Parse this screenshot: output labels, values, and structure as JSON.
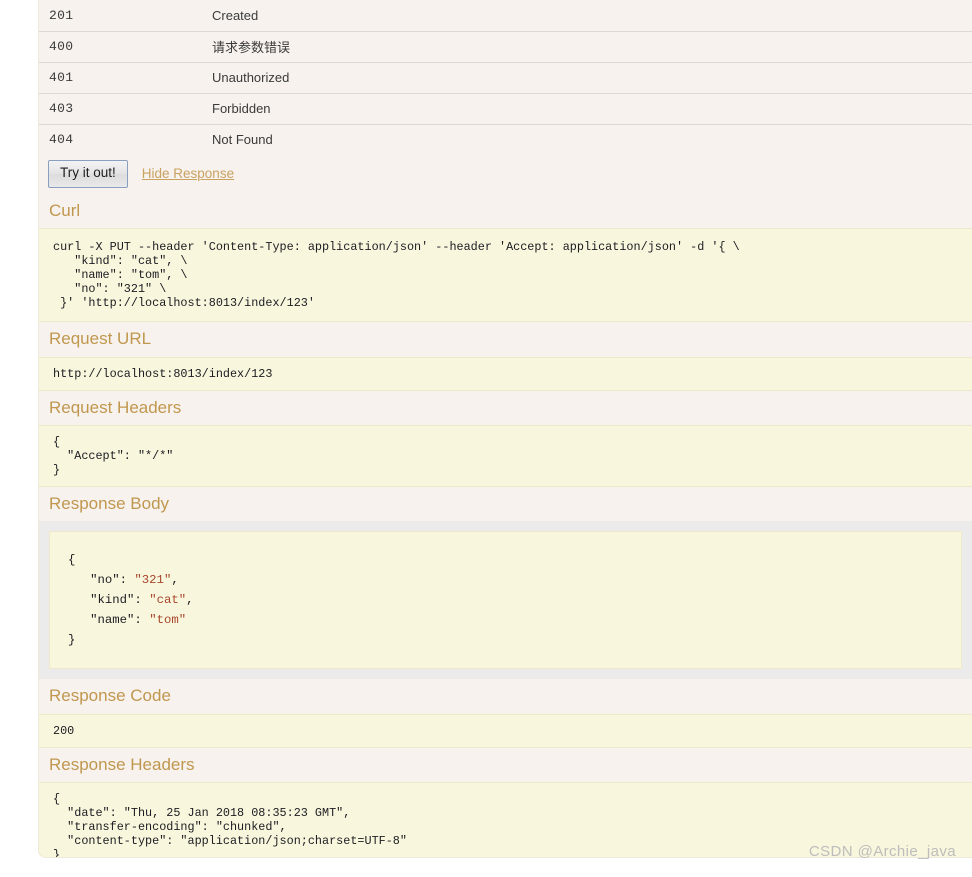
{
  "response_codes": {
    "rows": [
      {
        "code": "201",
        "reason": "Created"
      },
      {
        "code": "400",
        "reason": "请求参数错误"
      },
      {
        "code": "401",
        "reason": "Unauthorized"
      },
      {
        "code": "403",
        "reason": "Forbidden"
      },
      {
        "code": "404",
        "reason": "Not Found"
      }
    ]
  },
  "actions": {
    "try_it_out_label": "Try it out!",
    "hide_response_label": "Hide Response"
  },
  "sections": {
    "curl": {
      "title": "Curl",
      "content": "curl -X PUT --header 'Content-Type: application/json' --header 'Accept: application/json' -d '{ \\\n   \"kind\": \"cat\", \\\n   \"name\": \"tom\", \\\n   \"no\": \"321\" \\\n }' 'http://localhost:8013/index/123'"
    },
    "request_url": {
      "title": "Request URL",
      "content": "http://localhost:8013/index/123"
    },
    "request_headers": {
      "title": "Request Headers",
      "content": "{\n  \"Accept\": \"*/*\"\n}"
    },
    "response_body": {
      "title": "Response Body",
      "lines": [
        {
          "indent": 0,
          "text": "{",
          "type": "punct"
        },
        {
          "indent": 1,
          "key": "\"no\"",
          "value": "\"321\"",
          "trail": ","
        },
        {
          "indent": 1,
          "key": "\"kind\"",
          "value": "\"cat\"",
          "trail": ","
        },
        {
          "indent": 1,
          "key": "\"name\"",
          "value": "\"tom\"",
          "trail": ""
        },
        {
          "indent": 0,
          "text": "}",
          "type": "punct"
        }
      ],
      "content_plain": "{\n   \"no\": \"321\",\n   \"kind\": \"cat\",\n   \"name\": \"tom\"\n}"
    },
    "response_code": {
      "title": "Response Code",
      "content": "200"
    },
    "response_headers": {
      "title": "Response Headers",
      "content": "{\n  \"date\": \"Thu, 25 Jan 2018 08:35:23 GMT\",\n  \"transfer-encoding\": \"chunked\",\n  \"content-type\": \"application/json;charset=UTF-8\"\n}"
    }
  },
  "watermark": "CSDN @Archie_java",
  "colors": {
    "panel_background": "#f7f2ee",
    "code_background": "#f8f6dc",
    "section_title": "#c0974e",
    "link": "#c9a161",
    "json_value": "#a8462c",
    "shell_background": "#ebebeb"
  }
}
